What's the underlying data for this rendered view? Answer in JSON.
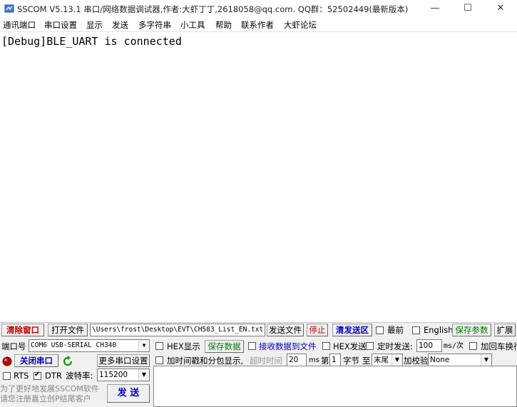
{
  "window": {
    "title": "SSCOM V5.13.1 串口/网络数据调试器,作者:大虾丁丁,2618058@qq.com. QQ群：52502449(最新版本)",
    "minimize": "—",
    "maximize": "☐",
    "close": "✕"
  },
  "menu": [
    "通讯端口",
    "串口设置",
    "显示",
    "发送",
    "多字符串",
    "小工具",
    "帮助",
    "联系作者",
    "大虾论坛"
  ],
  "output": {
    "line": "[Debug]BLE_UART is connected"
  },
  "row1": {
    "clear_window": "清除窗口",
    "open_file": "打开文件",
    "file_path": "\\Users\\frost\\Desktop\\EVT\\CH583_List_EN.txt",
    "send_file": "发送文件",
    "stop": "停止",
    "clear_send": "清发送区",
    "front_most": "最前",
    "english": "English",
    "save_params": "保存参数",
    "expand": "扩展"
  },
  "row2": {
    "port_label": "端口号",
    "port_value": "COM6 USB-SERIAL CH340",
    "hex_display": "HEX显示",
    "save_data": "保存数据",
    "recv_to_file": "接收数据到文件",
    "hex_send": "HEX发送",
    "timed_send": "定时发送:",
    "interval": "100",
    "interval_unit": "ms/次",
    "add_crlf": "加回车换行"
  },
  "row3": {
    "close_port": "关闭串口",
    "more_settings": "更多串口设置",
    "timestamp": "加时间戳和分包显示,",
    "timeout_label": "超时时间",
    "timeout_value": "20",
    "timeout_unit": "ms",
    "byte_prefix": "第",
    "byte_value": "1",
    "byte_label": "字节",
    "to_label": "至",
    "end_value": "末尾",
    "checksum_label": "加校验",
    "checksum_value": "None"
  },
  "row4": {
    "rts": "RTS",
    "dtr": "DTR",
    "baud_label": "波特率:",
    "baud_value": "115200"
  },
  "promo": {
    "line1": "为了更好地发展SSCOM软件",
    "line2": "请您注册嘉立创P结尾客户"
  },
  "send_button": "发 送",
  "colors": {
    "red_text": "#c00000",
    "green_text": "#007a00",
    "blue_text": "#0000c0"
  }
}
